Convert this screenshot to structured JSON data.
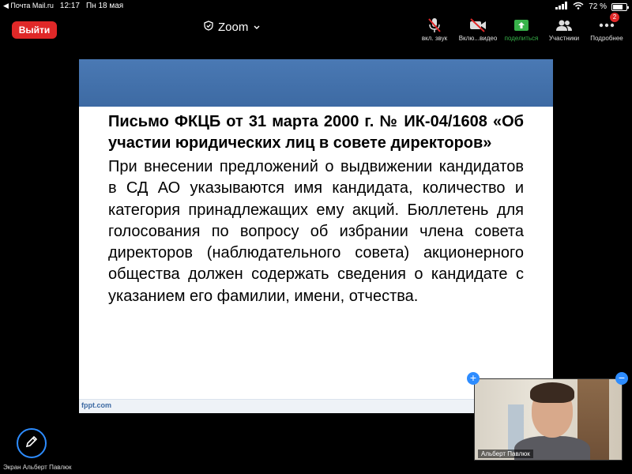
{
  "status_bar": {
    "back_app": "Почта Mail.ru",
    "time": "12:17",
    "date": "Пн 18 мая",
    "battery": "72 %",
    "battery_level": 0.72
  },
  "toolbar": {
    "leave_label": "Выйти",
    "title": "Zoom",
    "mute_label": "вкл. звук",
    "video_label": "Вклю...видео",
    "share_label": "поделиться",
    "participants_label": "Участники",
    "more_label": "Подробнее",
    "more_badge": "2",
    "share_color": "#38b34a",
    "leave_color": "#e02828"
  },
  "slide": {
    "title": "Письмо ФКЦБ от 31 марта 2000 г. № ИК-04/1608 «Об участии юридических лиц в совете директоров»",
    "body": "При внесении предложений о выдвижении кандидатов в СД АО указываются имя кандидата, количество и категория принадлежащих ему акций. Бюллетень для голосования по вопросу об избрании члена совета директоров (наблюдательного совета) акционерного общества должен содержать сведения о кандидате с указанием его фамилии, имени, отчества.",
    "footer": "fppt.com",
    "band_color": "#4a79b4"
  },
  "self_video": {
    "name": "Альберт Павлюк"
  },
  "annotate": {
    "label": "Экран Альберт Павлюк"
  }
}
